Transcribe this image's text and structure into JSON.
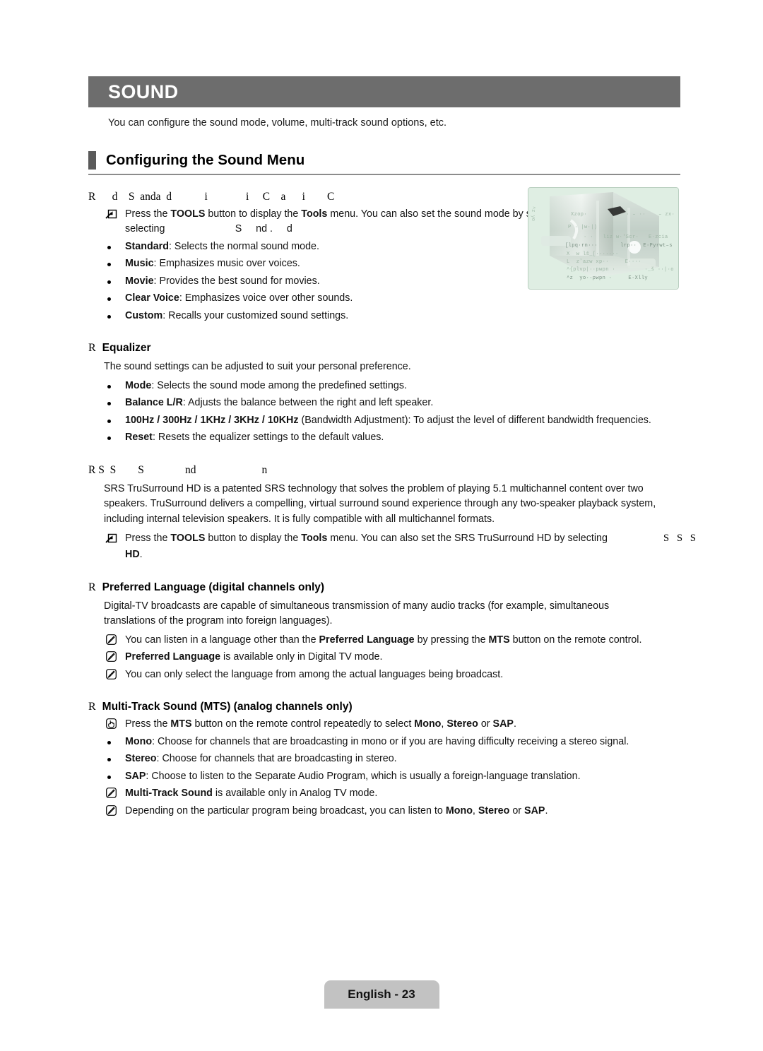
{
  "chapter": {
    "title": "SOUND",
    "intro": "You can configure the sound mode, volume, multi-track sound options, etc."
  },
  "section": {
    "heading": "Configuring the Sound Menu"
  },
  "sound_mode": {
    "fragmented_heading_marker": "R",
    "fragmented_heading": "R      d    S  anda  d            i              i     C    a      i        C",
    "tools_note_icon": "tools-icon",
    "tools_note_parts": {
      "a": "Press the ",
      "b1": "TOOLS",
      "c": " button to display the ",
      "b2": "Tools",
      "d": " menu. You can also set the sound mode by selecting"
    },
    "tools_note_continuation": "selecting                         S     nd .     d",
    "items": [
      {
        "term": "Standard",
        "desc": ": Selects the normal sound mode."
      },
      {
        "term": "Music",
        "desc": ": Emphasizes music over voices."
      },
      {
        "term": "Movie",
        "desc": ": Provides the best sound for movies."
      },
      {
        "term": "Clear Voice",
        "desc": ": Emphasizes voice over other sounds."
      },
      {
        "term": "Custom",
        "desc": ": Recalls your customized sound settings."
      }
    ]
  },
  "equalizer": {
    "marker": "R",
    "heading": "Equalizer",
    "intro": "The sound settings can be adjusted to suit your personal preference.",
    "items": [
      {
        "term": "Mode",
        "desc": ": Selects the sound mode among the predefined settings."
      },
      {
        "term": "Balance L/R",
        "desc": ": Adjusts the balance between the right and left speaker."
      },
      {
        "term": "100Hz / 300Hz / 1KHz / 3KHz / 10KHz",
        "desc": " (Bandwidth Adjustment): To adjust the level of different bandwidth frequencies."
      },
      {
        "term": "Reset",
        "desc": ": Resets the equalizer settings to the default values."
      }
    ]
  },
  "srs": {
    "fragmented_heading": "R S  S        S               nd                        n",
    "body": "SRS TruSurround HD is a patented SRS technology that solves the problem of playing 5.1 multichannel content over two speakers. TruSurround delivers a compelling, virtual surround sound experience through any two-speaker playback system, including internal television speakers. It is fully compatible with all multichannel formats.",
    "tools_note_icon": "tools-icon",
    "tools_note_parts": {
      "a": "Press the ",
      "b1": "TOOLS",
      "c": " button to display the ",
      "b2": "Tools",
      "d": " menu. You can also set the SRS TruSurround HD by selecting"
    },
    "stray_glyphs": "S   S   S",
    "tools_note_continuation": "HD",
    "tools_note_continuation_tail": "."
  },
  "preferred_language": {
    "marker": "R",
    "heading": "Preferred Language (digital channels only)",
    "intro": "Digital-TV broadcasts are capable of simultaneous transmission of many audio tracks (for example, simultaneous translations of the program into foreign languages).",
    "notes": [
      {
        "icon": "note-icon",
        "a": "You can listen in a language other than the ",
        "b1": "Preferred Language",
        "c": " by pressing the ",
        "b2": "MTS",
        "d": " button on the remote control."
      },
      {
        "icon": "note-icon",
        "b1": "Preferred Language",
        "d": " is available only in Digital TV mode.",
        "a": "",
        "c": "",
        "b2": ""
      },
      {
        "icon": "note-icon",
        "a": "You can only select the language from among the actual languages being broadcast.",
        "b1": "",
        "c": "",
        "b2": "",
        "d": ""
      }
    ]
  },
  "mts": {
    "marker": "R",
    "heading": "Multi-Track Sound (MTS) (analog channels only)",
    "hand_note": {
      "icon": "hand-icon",
      "a": "Press the ",
      "b1": "MTS",
      "c": " button on the remote control repeatedly to select ",
      "b2": "Mono",
      "d": ", ",
      "b3": "Stereo",
      "e": " or ",
      "b4": "SAP",
      "f": "."
    },
    "items": [
      {
        "term": "Mono",
        "desc": ": Choose for channels that are broadcasting in mono or if you are having difficulty receiving a stereo signal."
      },
      {
        "term": "Stereo",
        "desc": ": Choose for channels that are broadcasting in stereo."
      },
      {
        "term": "SAP",
        "desc": ": Choose to listen to the Separate Audio Program, which is usually a foreign-language translation."
      }
    ],
    "notes": [
      {
        "icon": "note-icon",
        "b1": "Multi-Track Sound",
        "d": " is available only in Analog TV mode."
      },
      {
        "icon": "note-icon",
        "a": "Depending on the particular program being broadcast, you can listen to ",
        "b1": "Mono",
        "c": ", ",
        "b2": "Stereo",
        "d": " or ",
        "b3": "SAP",
        "e": "."
      }
    ]
  },
  "thumbnail": {
    "alt": "tv-sound-menu-screenshot",
    "garbled_lines": [
      "Xzop·            · – ··    – zx·",
      "P · |w·|)",
      "· ·   liz w·'Scr·   E·zcia",
      "[lpq·rn···       lrp··  E·Pyrwt–s",
      "X  w lš_[·······",
      "L  zˇazw xp··     E····",
      "^{plvp|··pwpn ·         ·_š ··|·o",
      "^z  yo··pwpn ·     E·Xlly"
    ],
    "vertical_text": "^z  yo"
  },
  "footer": {
    "page_label": "English - 23"
  },
  "colors": {
    "chapter_bar": "#6d6d6d",
    "section_tab": "#5a5a5a",
    "section_rule": "#8c8c8c",
    "footer_pill": "#c2c2c2",
    "thumb_bg": "#dfeee3"
  }
}
